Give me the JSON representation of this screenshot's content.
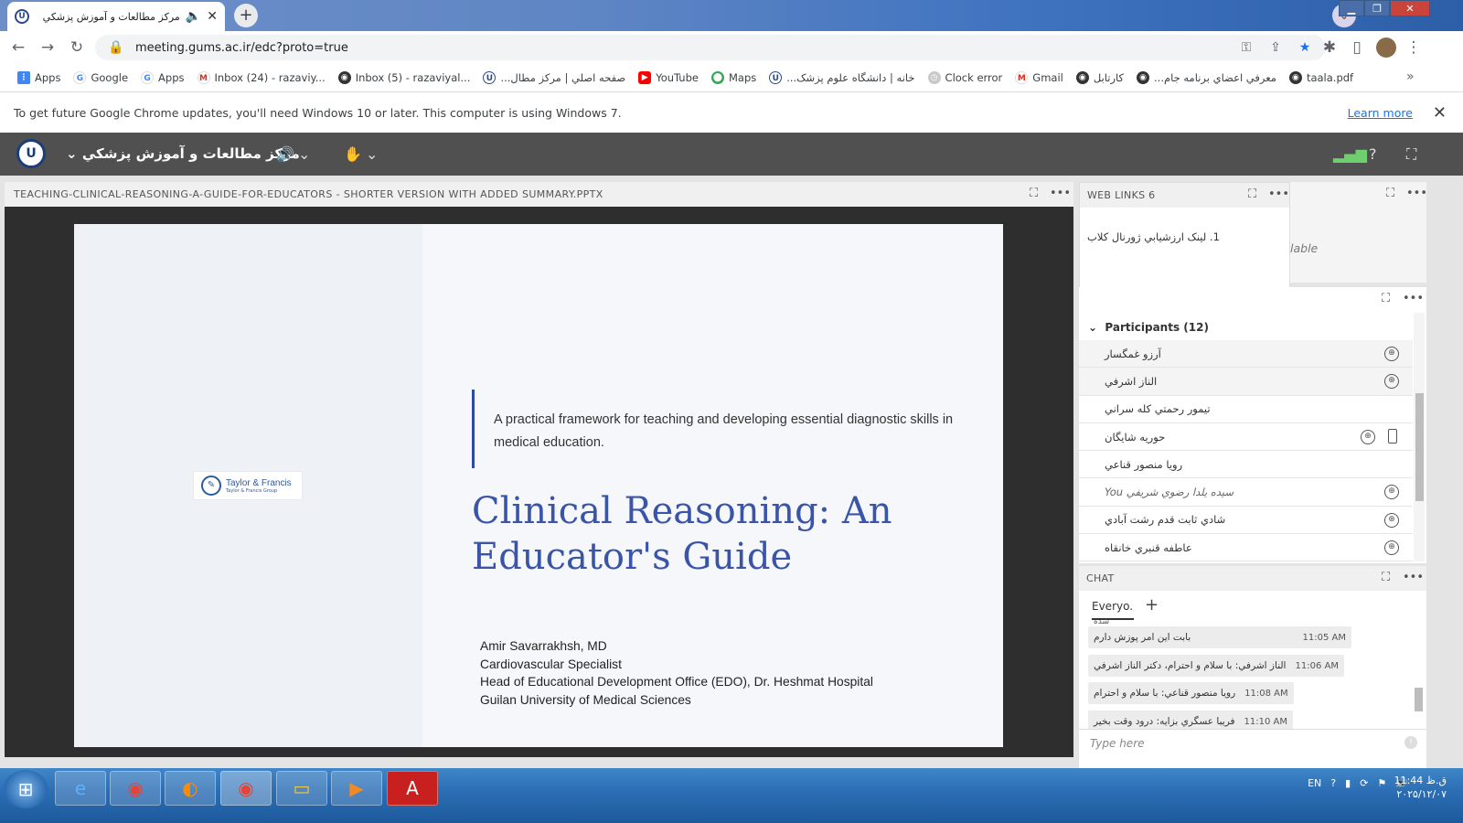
{
  "browser": {
    "tab_title": "مرکز مطالعات و آموزش پزشکي",
    "url": "meeting.gums.ac.ir/edc?proto=true",
    "bookmarks": [
      {
        "label": "Apps",
        "icon": "apps-grid-icon"
      },
      {
        "label": "Google",
        "icon": "google-icon"
      },
      {
        "label": "Apps",
        "icon": "google-icon"
      },
      {
        "label": "Inbox (24) - razaviy...",
        "icon": "gmail-icon"
      },
      {
        "label": "Inbox (5) - razaviyal...",
        "icon": "globe-icon"
      },
      {
        "label": "صفحه اصلي | مرکز مطال...",
        "icon": "university-icon"
      },
      {
        "label": "YouTube",
        "icon": "youtube-icon"
      },
      {
        "label": "Maps",
        "icon": "maps-icon"
      },
      {
        "label": "خانه | دانشگاه علوم پزشک...",
        "icon": "university-icon"
      },
      {
        "label": "Clock error",
        "icon": "clock-icon"
      },
      {
        "label": "Gmail",
        "icon": "gmail-icon"
      },
      {
        "label": "کارتابل",
        "icon": "globe-icon"
      },
      {
        "label": "معرفي اعضاي برنامه جام...",
        "icon": "globe-icon"
      },
      {
        "label": "taala.pdf",
        "icon": "globe-icon"
      }
    ],
    "infobar": {
      "message": "To get future Google Chrome updates, you'll need Windows 10 or later. This computer is using Windows 7.",
      "learn_more": "Learn more"
    }
  },
  "meeting": {
    "room_title": "مرکز مطالعات و آموزش پزشکي",
    "share_pod": {
      "title": "TEACHING-CLINICAL-REASONING-A-GUIDE-FOR-EDUCATORS - SHORTER VERSION WITH ADDED SUMMARY.PPTX",
      "slide": {
        "logo_name": "Taylor & Francis",
        "logo_sub": "Taylor & Francis Group",
        "subtitle": "A practical framework for teaching and developing essential diagnostic skills in medical education.",
        "title": "Clinical Reasoning: An Educator's Guide",
        "author_lines": [
          "Amir Savarrakhsh, MD",
          "Cardiovascular Specialist",
          "Head of Educational Development Office (EDO), Dr. Heshmat Hospital",
          "Guilan University of Medical Sciences"
        ]
      }
    },
    "weblinks": {
      "title": "WEB LINKS 6",
      "items": [
        "1. لينک ارزشيابي ژورنال کلاب"
      ]
    },
    "side_fragment": "lable",
    "participants": {
      "header": "Participants (12)",
      "list": [
        {
          "name": "آرزو غمگسار",
          "icons": [
            "globe-icon"
          ]
        },
        {
          "name": "الناز اشرفي",
          "icons": [
            "globe-icon"
          ]
        },
        {
          "name": "تيمور رحمتي کله سراني",
          "icons": []
        },
        {
          "name": "حوريه شايگان",
          "icons": [
            "globe-icon",
            "phone-icon"
          ]
        },
        {
          "name": "رويا منصور قناعي",
          "icons": []
        },
        {
          "name": "سيده يلدا رضوي شريفي You",
          "icons": [
            "globe-icon"
          ],
          "you": true
        },
        {
          "name": "شادي ثابت قدم رشت آبادي",
          "icons": [
            "globe-icon"
          ]
        },
        {
          "name": "عاطفه قنبري خانقاه",
          "icons": [
            "globe-icon"
          ]
        }
      ]
    },
    "chat": {
      "title": "CHAT",
      "tab": "Everyo...",
      "cut_text": "شده",
      "messages": [
        {
          "text": "بابت اين امر پوزش دارم",
          "time": "11:05 AM"
        },
        {
          "text": "الناز اشرفي: با سلام و احترام، دکتر الناز اشرفي",
          "time": "11:06 AM"
        },
        {
          "text": "رويا منصور قناعي: با سلام و احترام",
          "time": "11:08 AM"
        },
        {
          "text": "فريبا عسگري بزايه: درود وقت بخير",
          "time": "11:10 AM"
        }
      ],
      "input_placeholder": "Type here"
    }
  },
  "taskbar": {
    "language": "EN",
    "time": "11:44 ق.ظ",
    "date": "۲۰۲۵/۱۲/۰۷"
  },
  "colors": {
    "connect_header": "#505050",
    "slide_title": "#3a55a8",
    "chrome_link": "#1a73e8"
  }
}
